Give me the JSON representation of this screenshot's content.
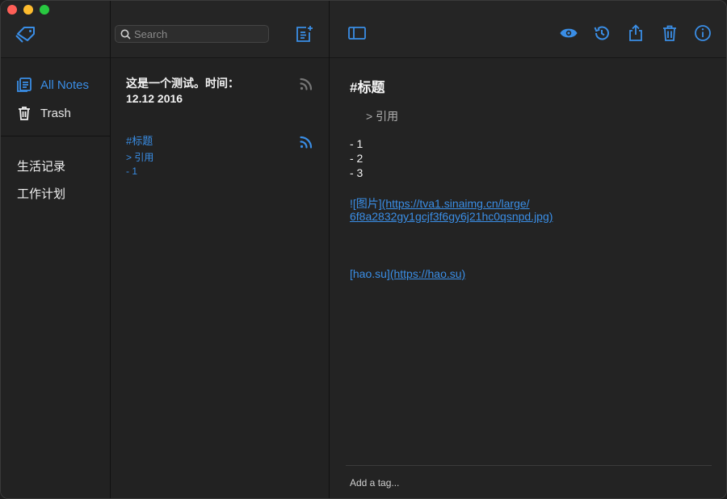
{
  "sidebar": {
    "nav": [
      {
        "label": "All Notes",
        "icon": "notes-stack-icon",
        "active": true
      },
      {
        "label": "Trash",
        "icon": "trash-icon",
        "active": false
      }
    ],
    "tags": [
      "生活记录",
      "工作计划"
    ]
  },
  "notelist": {
    "search_placeholder": "Search",
    "notes": [
      {
        "title_line1": "这是一个测试。时间：",
        "title_line2": "12.12  2016",
        "preview": []
      },
      {
        "title_line1": "#标题",
        "title_line2": "",
        "preview": [
          "> 引用",
          "- 1"
        ]
      }
    ]
  },
  "editor": {
    "content": {
      "heading": "#标题",
      "quote": "> 引用",
      "list": [
        "- 1",
        "- 2",
        "- 3"
      ],
      "image_link_line1_text": "![图片]",
      "image_link_line1_url": "(https://tva1.sinaimg.cn/large/",
      "image_link_line2": "6f8a2832gy1gcjf3f6gy6j21hc0qsnpd.jpg)",
      "link_text": "[hao.su]",
      "link_url": "(https://hao.su)"
    },
    "add_tag_placeholder": "Add a tag..."
  },
  "colors": {
    "accent": "#3a8ee6",
    "background": "#1f1f1f"
  }
}
